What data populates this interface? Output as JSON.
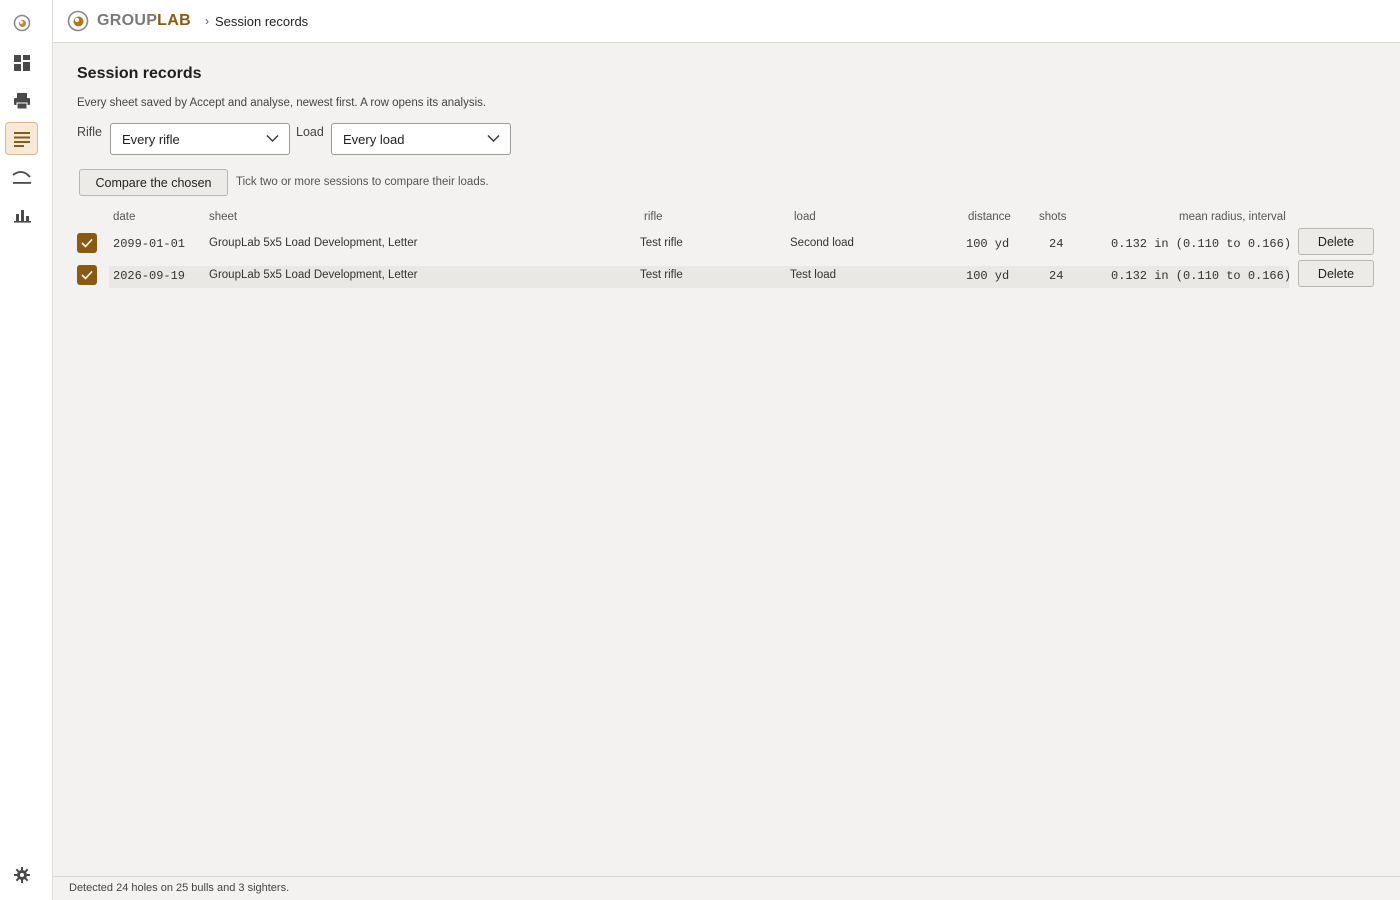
{
  "app": {
    "brand_prefix": "GROUP",
    "brand_suffix": "LAB",
    "brand_color": "#8a5a12"
  },
  "breadcrumb": {
    "separator": "›",
    "current": "Session records"
  },
  "sidebar": {
    "items": [
      {
        "icon": "target-logo-icon"
      },
      {
        "icon": "dashboard-icon"
      },
      {
        "icon": "printer-icon"
      },
      {
        "icon": "list-icon",
        "active": true
      },
      {
        "icon": "trajectory-icon"
      },
      {
        "icon": "bar-chart-icon"
      }
    ],
    "bottom_icon": "gear-icon"
  },
  "page": {
    "title": "Session records",
    "description": "Every sheet saved by Accept and analyse, newest first. A row opens its analysis."
  },
  "filters": {
    "rifle_label": "Rifle",
    "rifle_value": "Every rifle",
    "load_label": "Load",
    "load_value": "Every load"
  },
  "compare": {
    "button_label": "Compare the chosen",
    "hint": "Tick two or more sessions to compare their loads."
  },
  "table": {
    "headers": {
      "date": "date",
      "sheet": "sheet",
      "rifle": "rifle",
      "load": "load",
      "distance": "distance",
      "shots": "shots",
      "mean": "mean radius, interval"
    },
    "rows": [
      {
        "checked": true,
        "date": "2099-01-01",
        "sheet": "GroupLab 5x5 Load Development, Letter",
        "rifle": "Test rifle",
        "load": "Second load",
        "distance": "100 yd",
        "shots": "24",
        "mean": "0.132 in (0.110 to 0.166)",
        "delete_label": "Delete"
      },
      {
        "checked": true,
        "date": "2026-09-19",
        "sheet": "GroupLab 5x5 Load Development, Letter",
        "rifle": "Test rifle",
        "load": "Test load",
        "distance": "100 yd",
        "shots": "24",
        "mean": "0.132 in (0.110 to 0.166)",
        "delete_label": "Delete"
      }
    ]
  },
  "status": {
    "text": "Detected 24 holes on 25 bulls and 3 sighters."
  },
  "colors": {
    "accent": "#8a5a12",
    "active_bg": "#f6e9d7",
    "page_bg": "#f3f2f0"
  }
}
